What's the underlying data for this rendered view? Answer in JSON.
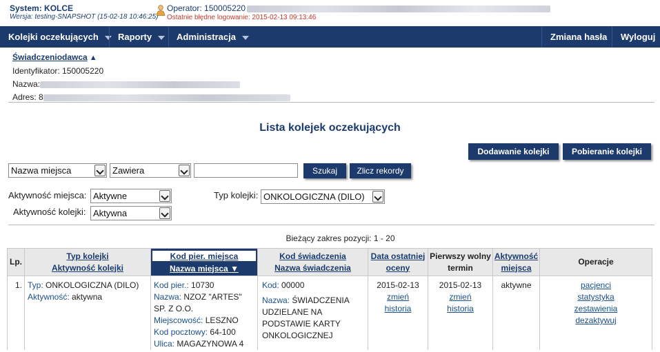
{
  "top": {
    "system": "System: KOLCE",
    "version": "Wersja: testing-SNAPSHOT (15-02-18 10:46:25)",
    "operator": "Operator: 150005220",
    "last_login": "Ostatnie błędne logowanie: 2015-02-13 09:13:46"
  },
  "nav": {
    "queues": "Kolejki oczekujących",
    "reports": "Raporty",
    "admin": "Administracja",
    "change_password": "Zmiana hasła",
    "logout": "Wyloguj"
  },
  "provider": {
    "title": "Świadczeniodawca",
    "id_label": "Identyfikator:",
    "id_value": "150005220",
    "name_label": "Nazwa:",
    "address_label": "Adres:",
    "address_prefix": "8"
  },
  "page_title": "Lista kolejek oczekujących",
  "buttons": {
    "add_queue": "Dodawanie kolejki",
    "get_queue": "Pobieranie kolejki",
    "search": "Szukaj",
    "count": "Zlicz rekordy"
  },
  "filters": {
    "field": "Nazwa miejsca",
    "condition": "Zawiera",
    "search_value": "",
    "place_activity_label": "Aktywność miejsca:",
    "place_activity_value": "Aktywne",
    "queue_activity_label": "Aktywność kolejki:",
    "queue_activity_value": "Aktywna",
    "queue_type_label": "Typ kolejki:",
    "queue_type_value": "ONKOLOGICZNA (DILO)"
  },
  "range": "Bieżący zakres pozycji: 1 - 20",
  "table": {
    "headers": {
      "lp": "Lp.",
      "type_1": "Typ kolejki",
      "type_2": "Aktywność kolejki",
      "code_1": "Kod pier. miejsca",
      "code_2": "Nazwa miejsca",
      "service_1": "Kod świadczenia",
      "service_2": "Nazwa świadczenia",
      "last_date_1": "Data ostatniej",
      "last_date_2": "oceny",
      "first_free_1": "Pierwszy wolny",
      "first_free_2": "termin",
      "activity_1": "Aktywność",
      "activity_2": "miejsca",
      "operations": "Operacje"
    },
    "row": {
      "lp": "1.",
      "type_label": "Typ:",
      "type_value": "ONKOLOGICZNA (DILO)",
      "activity_label": "Aktywność:",
      "activity_value": "aktywna",
      "code_label": "Kod pier.:",
      "code_value": "10730",
      "name_label": "Nazwa:",
      "name_value_1": "NZOZ \"ARTES\"",
      "name_value_2": "SP. Z O.O.",
      "city_label": "Miejscowość:",
      "city_value": "LESZNO",
      "postal_label": "Kod pocztowy:",
      "postal_value": "64-100",
      "street_label": "Ulica:",
      "street_value": "MAGAZYNOWA 4",
      "service_code_label": "Kod:",
      "service_code_value": "00000",
      "service_name_label": "Nazwa:",
      "service_name_1": "ŚWIADCZENIA",
      "service_name_2": "UDZIELANE NA",
      "service_name_3": "PODSTAWIE KARTY",
      "service_name_4": "ONKOLOGICZNEJ",
      "last_date": "2015-02-13",
      "last_date_change": "zmień",
      "last_date_history": "historia",
      "first_free": "2015-02-13",
      "first_free_change": "zmień",
      "first_free_history": "historia",
      "place_activity": "aktywne",
      "op_patients": "pacjenci",
      "op_stats": "statystyka",
      "op_summaries": "zestawienia",
      "op_deactivate": "dezaktywuj"
    }
  },
  "colors": {
    "navy": "#1c3a6b",
    "link": "#1a4f8a",
    "warning": "#c0392b"
  }
}
